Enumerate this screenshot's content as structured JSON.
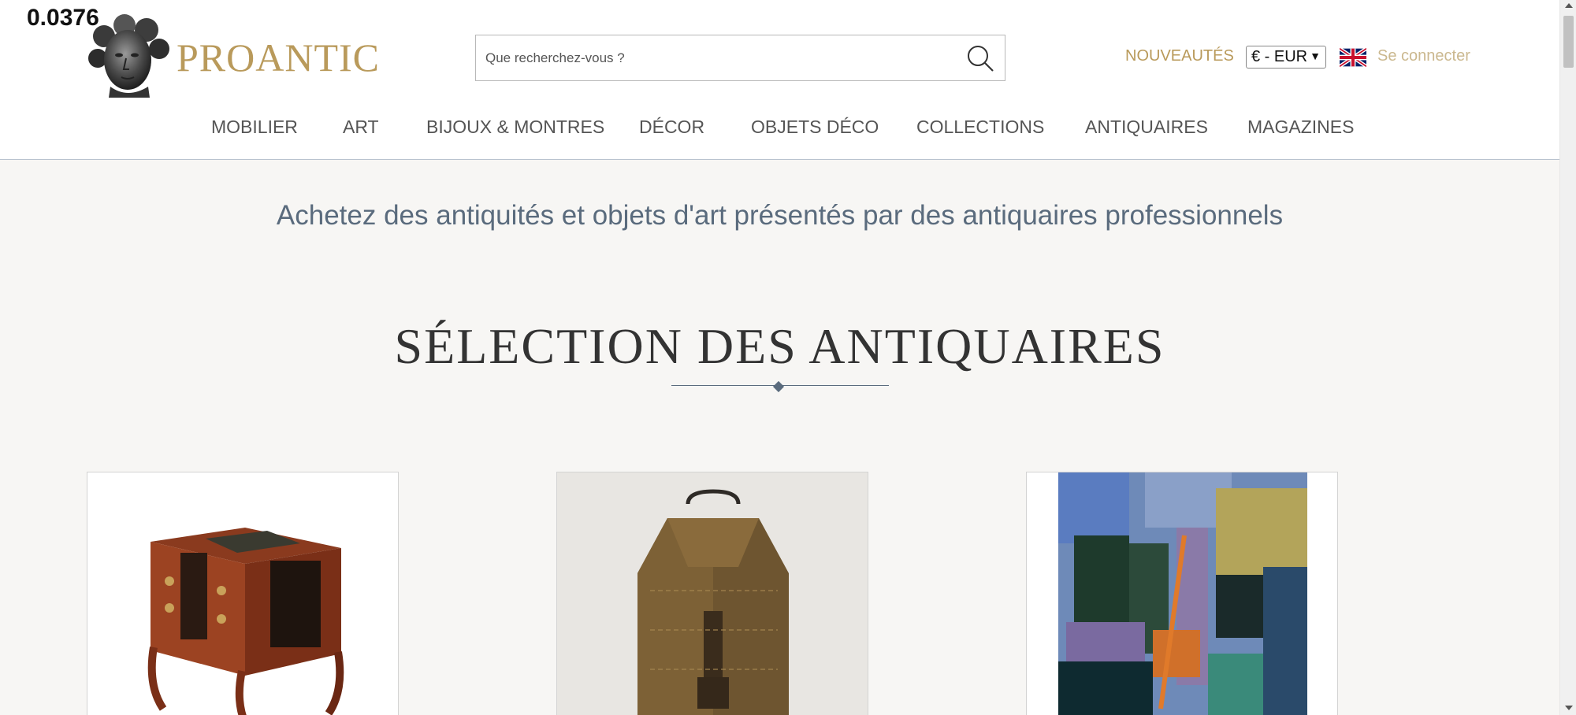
{
  "overlay": {
    "value": "0.0376"
  },
  "header": {
    "brand": "PROANTIC",
    "search": {
      "placeholder": "Que recherchez-vous ?"
    },
    "new_link": "NOUVEAUTÉS",
    "currency": "€ - EUR",
    "language_flag": "uk-flag-icon",
    "login": "Se connecter"
  },
  "nav": {
    "items": [
      {
        "label": "MOBILIER"
      },
      {
        "label": "ART"
      },
      {
        "label": "BIJOUX & MONTRES"
      },
      {
        "label": "DÉCOR"
      },
      {
        "label": "OBJETS DÉCO"
      },
      {
        "label": "COLLECTIONS"
      },
      {
        "label": "ANTIQUAIRES"
      },
      {
        "label": "MAGAZINES"
      }
    ]
  },
  "main": {
    "tagline": "Achetez des antiquités et objets d'art présentés par des antiquaires professionnels",
    "section_title": "SÉLECTION DES ANTIQUAIRES"
  },
  "colors": {
    "brand_gold": "#b99a5b",
    "slate": "#5a6b7d",
    "background": "#f7f6f4"
  }
}
